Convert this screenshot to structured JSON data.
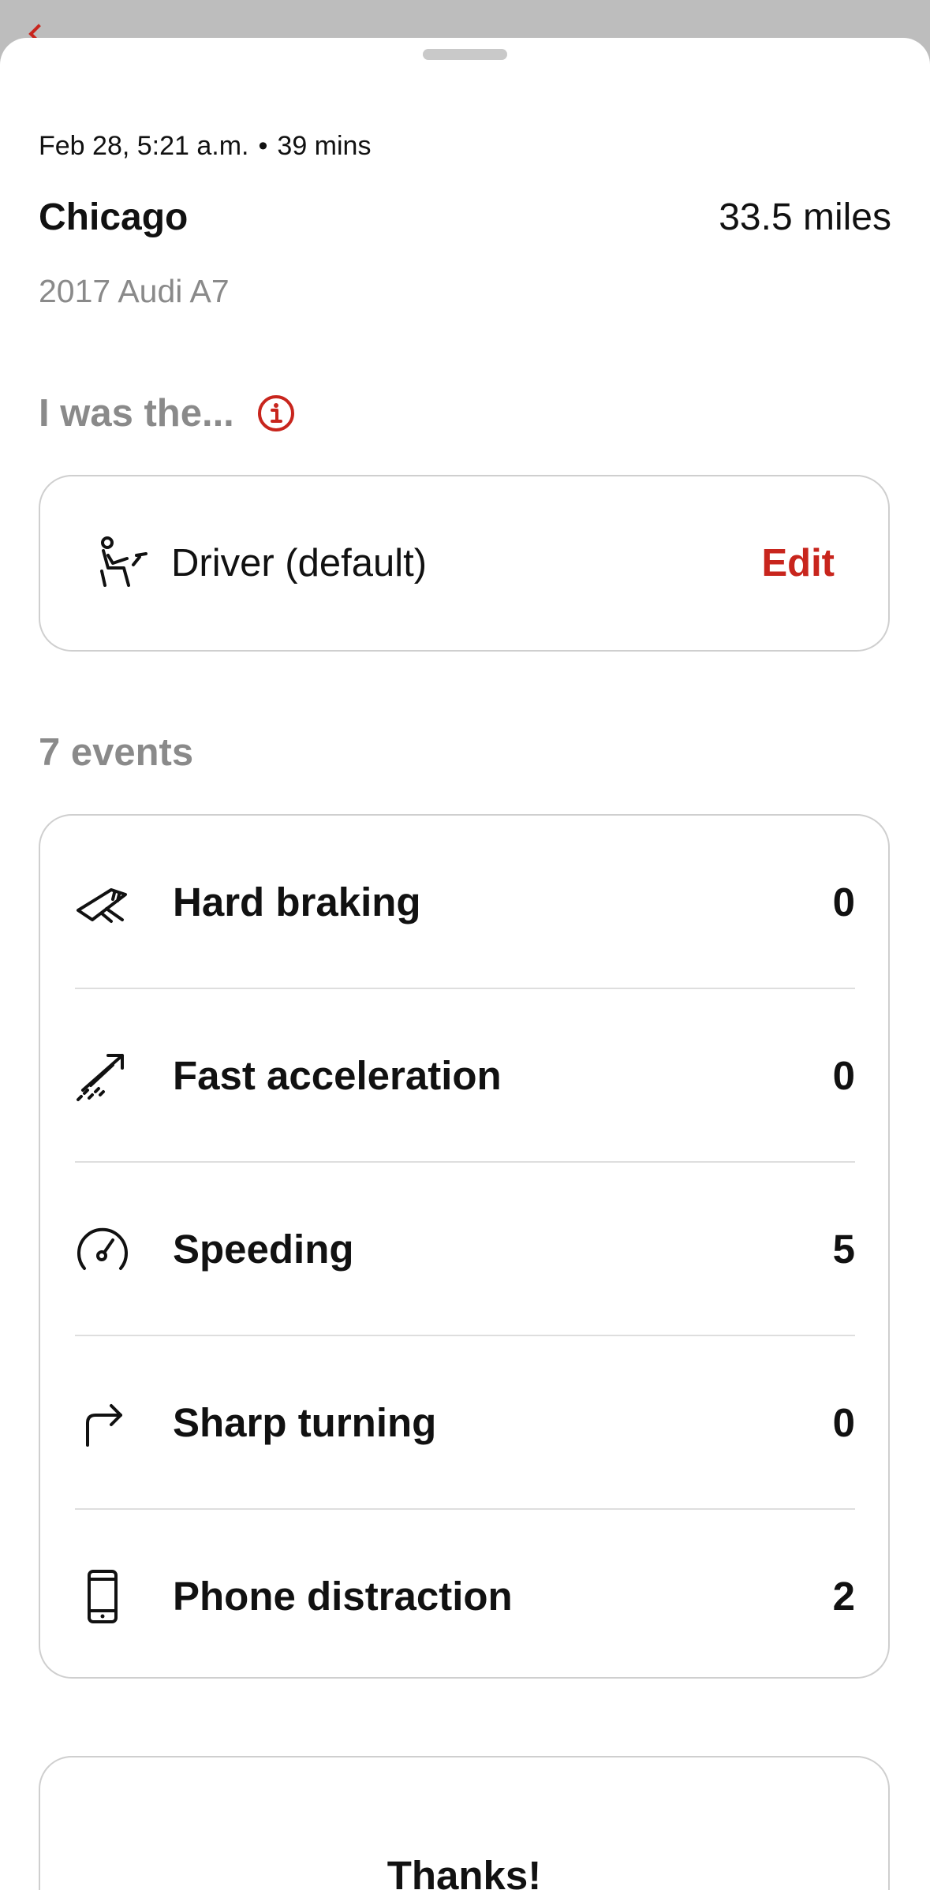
{
  "trip": {
    "date_time": "Feb 28, 5:21 a.m.",
    "duration": "39 mins",
    "city": "Chicago",
    "distance": "33.5 miles",
    "vehicle": "2017 Audi A7"
  },
  "role": {
    "heading": "I was the...",
    "info_icon": "info-icon",
    "selected": "Driver (default)",
    "selected_icon": "driver-seat-icon",
    "edit_label": "Edit"
  },
  "events": {
    "heading": "7 events",
    "items": [
      {
        "label": "Hard braking",
        "count": "0",
        "icon": "hard-braking-icon"
      },
      {
        "label": "Fast acceleration",
        "count": "0",
        "icon": "fast-acceleration-icon"
      },
      {
        "label": "Speeding",
        "count": "5",
        "icon": "speedometer-icon"
      },
      {
        "label": "Sharp turning",
        "count": "0",
        "icon": "turn-arrow-icon"
      },
      {
        "label": "Phone distraction",
        "count": "2",
        "icon": "phone-icon"
      }
    ]
  },
  "feedback": {
    "title": "Thanks!"
  },
  "colors": {
    "accent": "#c8251d",
    "muted_text": "#8a8a8a",
    "border": "#cfcfcf",
    "backdrop": "#bdbdbd"
  }
}
